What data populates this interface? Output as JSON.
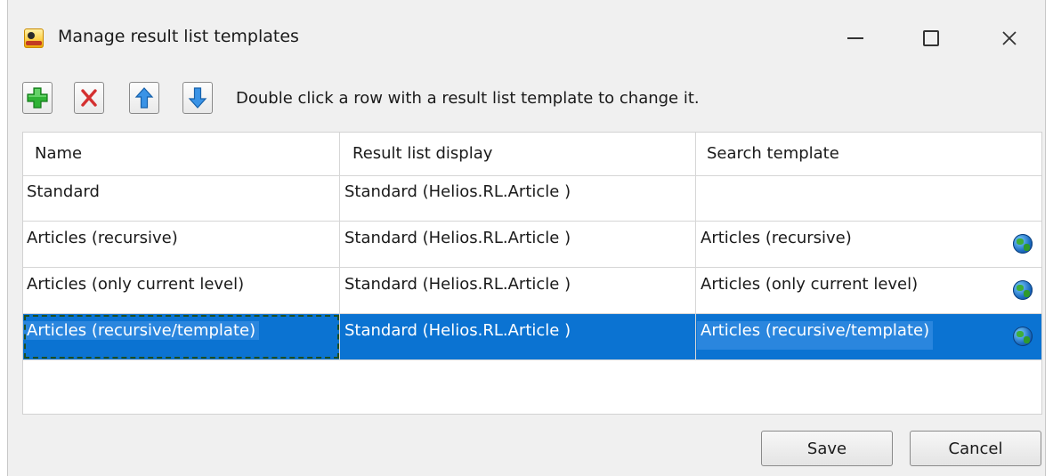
{
  "window": {
    "title": "Manage result list templates",
    "controls": {
      "minimize": "minimize",
      "maximize": "maximize",
      "close": "close"
    }
  },
  "toolbar": {
    "buttons": [
      {
        "name": "add",
        "icon": "green-plus-icon"
      },
      {
        "name": "delete",
        "icon": "red-x-icon"
      },
      {
        "name": "move-up",
        "icon": "arrow-up-icon"
      },
      {
        "name": "move-down",
        "icon": "arrow-down-icon"
      }
    ],
    "hint": "Double click a row with a result list template to change it."
  },
  "table": {
    "columns": [
      "Name",
      "Result list display",
      "Search template"
    ],
    "rows": [
      {
        "name": "Standard",
        "display": "Standard (Helios.RL.Article )",
        "search": "",
        "global_icon": false,
        "selected": false
      },
      {
        "name": "Articles (recursive)",
        "display": "Standard (Helios.RL.Article )",
        "search": "Articles (recursive)",
        "global_icon": true,
        "selected": false
      },
      {
        "name": "Articles (only current level)",
        "display": "Standard (Helios.RL.Article )",
        "search": "Articles (only current level)",
        "global_icon": true,
        "selected": false
      },
      {
        "name": "Articles (recursive/template)",
        "display": "Standard (Helios.RL.Article )",
        "search": "Articles (recursive/template)",
        "global_icon": true,
        "selected": true
      }
    ]
  },
  "footer": {
    "save_label": "Save",
    "cancel_label": "Cancel"
  },
  "colors": {
    "selection": "#0b73d2",
    "add": "#22a32a",
    "delete": "#d02a2a",
    "arrow": "#2a7fd6"
  }
}
